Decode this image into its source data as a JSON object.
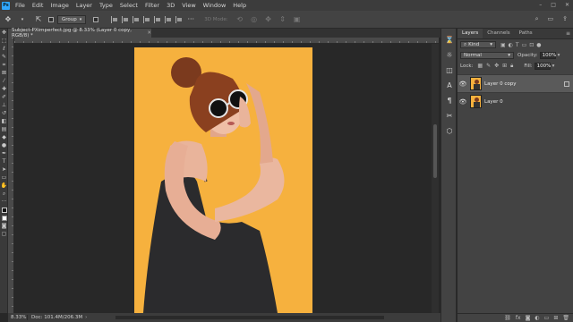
{
  "menu": {
    "items": [
      "File",
      "Edit",
      "Image",
      "Layer",
      "Type",
      "Select",
      "Filter",
      "3D",
      "View",
      "Window",
      "Help"
    ],
    "window_controls": [
      "–",
      "□",
      "✕"
    ]
  },
  "options": {
    "auto_select_value": "Group",
    "mode_3d_label": "3D Mode:"
  },
  "document": {
    "tab_title": "Subject-PXimperfect.jpg @ 8.33% (Layer 0 copy, RGB/8) *",
    "zoom": "8.33%",
    "doc_size": "Doc: 101.4M/206.3M"
  },
  "layers_panel": {
    "tabs": [
      "Layers",
      "Channels",
      "Paths"
    ],
    "filter_kind": "Kind",
    "blend_mode": "Normal",
    "opacity_label": "Opacity:",
    "opacity_value": "100%",
    "lock_label": "Lock:",
    "fill_label": "Fill:",
    "fill_value": "100%",
    "layers": [
      {
        "name": "Layer 0 copy",
        "selected": true
      },
      {
        "name": "Layer 0",
        "selected": false
      }
    ]
  },
  "colors": {
    "photo_background": "#f6b13e",
    "accent": "#31a8ff"
  }
}
